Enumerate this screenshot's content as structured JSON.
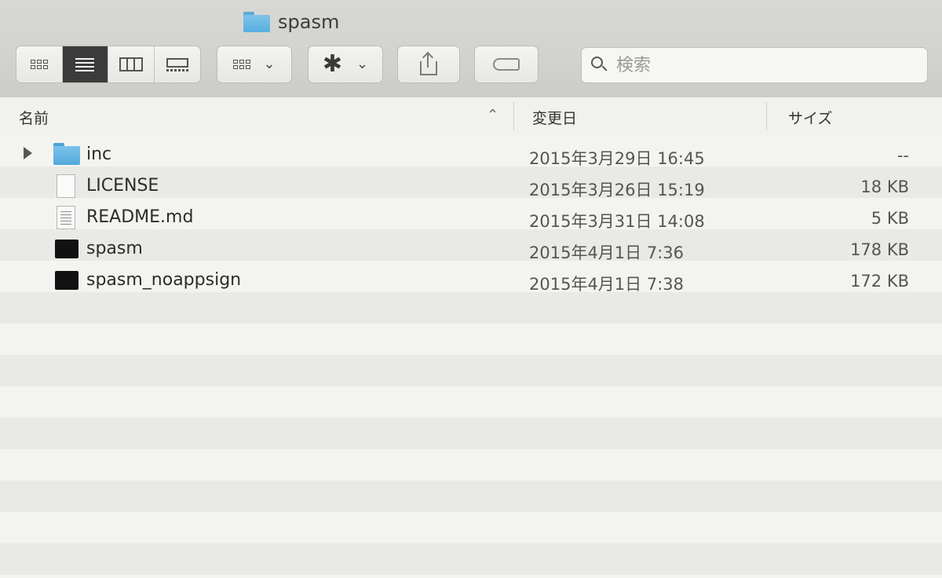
{
  "window": {
    "title": "spasm"
  },
  "toolbar": {
    "views": [
      {
        "name": "icon-view",
        "active": false
      },
      {
        "name": "list-view",
        "active": true
      },
      {
        "name": "column-view",
        "active": false
      },
      {
        "name": "cover-flow-view",
        "active": false
      }
    ],
    "search": {
      "placeholder": "検索"
    }
  },
  "columns": {
    "name": "名前",
    "date": "変更日",
    "size": "サイズ"
  },
  "files": [
    {
      "name": "inc",
      "date": "2015年3月29日 16:45",
      "size": "--",
      "kind": "folder",
      "expandable": true
    },
    {
      "name": "LICENSE",
      "date": "2015年3月26日 15:19",
      "size": "18 KB",
      "kind": "document",
      "expandable": false
    },
    {
      "name": "README.md",
      "date": "2015年3月31日 14:08",
      "size": "5 KB",
      "kind": "text",
      "expandable": false
    },
    {
      "name": "spasm",
      "date": "2015年4月1日 7:36",
      "size": "178 KB",
      "kind": "executable",
      "expandable": false
    },
    {
      "name": "spasm_noappsign",
      "date": "2015年4月1日 7:38",
      "size": "172 KB",
      "kind": "executable",
      "expandable": false
    }
  ],
  "colors": {
    "folder": "#58aee0",
    "active_view": "#3b3b3b"
  }
}
